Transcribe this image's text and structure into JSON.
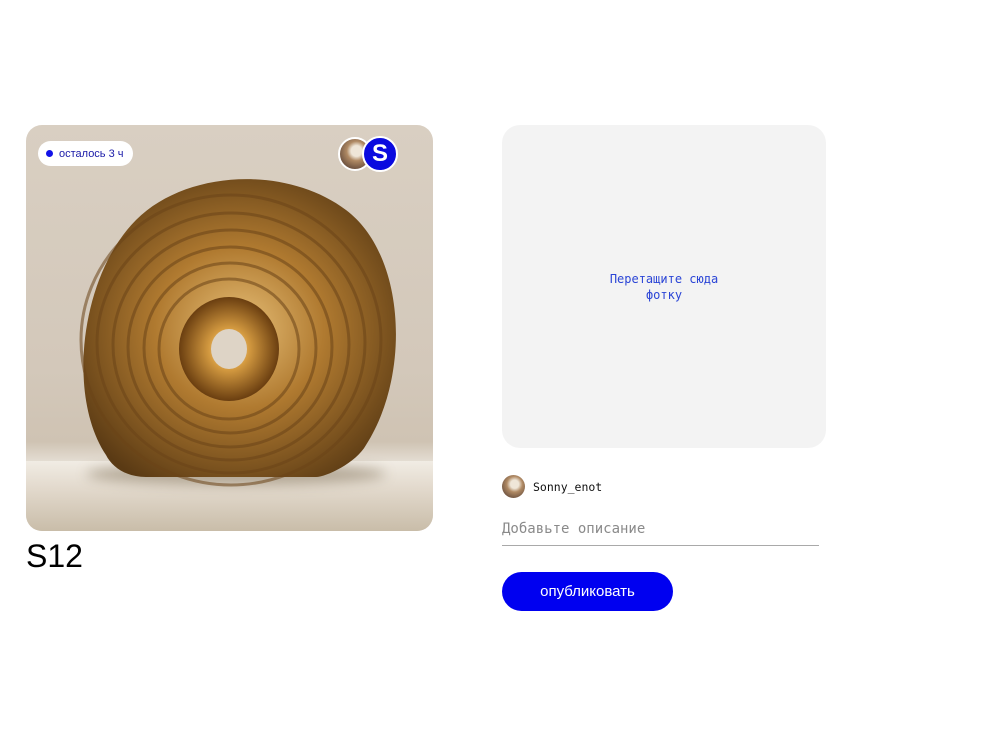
{
  "post": {
    "timer_label": "осталось 3 ч",
    "badge_letter": "S",
    "title": "S12",
    "image_subject": "ceramic-ring-vase"
  },
  "upload": {
    "dropzone_hint": "Перетащите сюда фотку"
  },
  "author": {
    "username": "Sonny_enot"
  },
  "form": {
    "description_placeholder": "Добавьте описание",
    "description_value": "",
    "publish_label": "опубликовать"
  },
  "colors": {
    "accent": "#0000f0",
    "dropzone_bg": "#f3f3f3",
    "hint_text": "#2b45d6"
  }
}
